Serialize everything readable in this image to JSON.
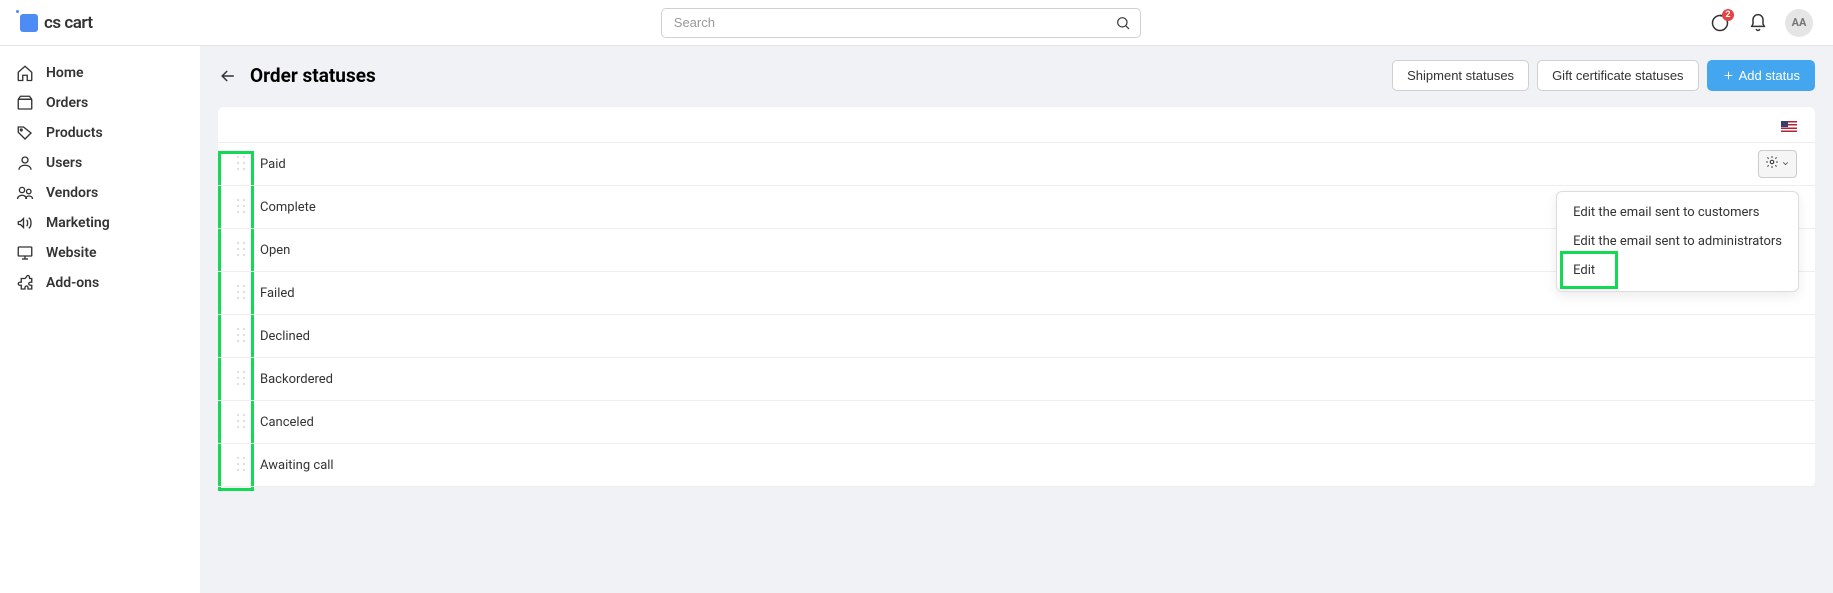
{
  "brand": "cs cart",
  "search": {
    "placeholder": "Search"
  },
  "notifications": {
    "badge": "2"
  },
  "avatar_initials": "AA",
  "sidebar": {
    "items": [
      {
        "label": "Home"
      },
      {
        "label": "Orders"
      },
      {
        "label": "Products"
      },
      {
        "label": "Users"
      },
      {
        "label": "Vendors"
      },
      {
        "label": "Marketing"
      },
      {
        "label": "Website"
      },
      {
        "label": "Add-ons"
      }
    ]
  },
  "page": {
    "title": "Order statuses",
    "actions": {
      "shipment": "Shipment statuses",
      "gift": "Gift certificate statuses",
      "add": "Add status"
    }
  },
  "statuses": [
    {
      "label": "Paid"
    },
    {
      "label": "Complete"
    },
    {
      "label": "Open"
    },
    {
      "label": "Failed"
    },
    {
      "label": "Declined"
    },
    {
      "label": "Backordered"
    },
    {
      "label": "Canceled"
    },
    {
      "label": "Awaiting call"
    }
  ],
  "dropdown": {
    "items": [
      {
        "label": "Edit the email sent to customers"
      },
      {
        "label": "Edit the email sent to administrators"
      },
      {
        "label": "Edit"
      }
    ]
  }
}
